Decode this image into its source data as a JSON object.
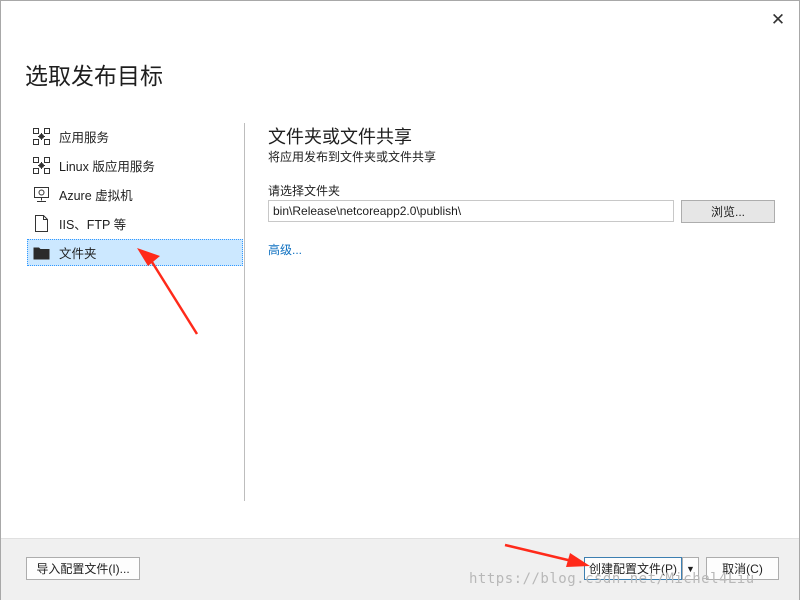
{
  "dialog": {
    "title": "选取发布目标",
    "close_glyph": "✕"
  },
  "targets": [
    {
      "label": "应用服务",
      "icon": "app-service-icon"
    },
    {
      "label": "Linux 版应用服务",
      "icon": "app-service-linux-icon"
    },
    {
      "label": "Azure 虚拟机",
      "icon": "virtual-machine-icon"
    },
    {
      "label": "IIS、FTP 等",
      "icon": "document-icon"
    },
    {
      "label": "文件夹",
      "icon": "folder-icon",
      "selected": true
    }
  ],
  "folder_panel": {
    "title": "文件夹或文件共享",
    "subtitle": "将应用发布到文件夹或文件共享",
    "folder_label": "请选择文件夹",
    "folder_value": "bin\\Release\\netcoreapp2.0\\publish\\",
    "browse_label": "浏览...",
    "advanced_label": "高级..."
  },
  "footer": {
    "import_label": "导入配置文件(I)...",
    "create_label": "创建配置文件(P)",
    "dropdown_glyph": "▼",
    "cancel_label": "取消(C)"
  },
  "watermark": "https://blog.csdn.net/Michel4Liu",
  "colors": {
    "selection_bg": "#cce8ff",
    "link": "#0e70c0",
    "annotation_arrow": "#ff2a1a"
  }
}
